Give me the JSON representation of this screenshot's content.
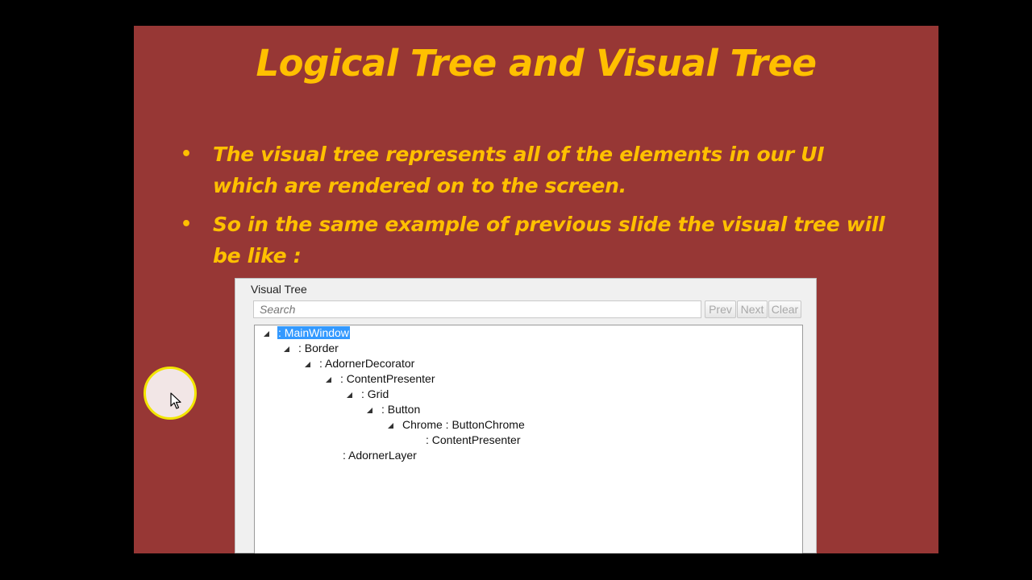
{
  "slide": {
    "title": "Logical Tree and Visual Tree",
    "bullets": [
      "The visual tree represents all of the elements in our UI which are rendered on to the screen.",
      "So in the same example of previous slide the visual tree will be like :"
    ],
    "bullet_glyph": "•"
  },
  "visual_tree_panel": {
    "title": "Visual Tree",
    "search_placeholder": "Search",
    "prev_label": "Prev",
    "next_label": "Next",
    "clear_label": "Clear",
    "nodes": [
      {
        "label": ": MainWindow",
        "expanded": true,
        "selected": true
      },
      {
        "label": ": Border",
        "expanded": true
      },
      {
        "label": ": AdornerDecorator",
        "expanded": true
      },
      {
        "label": ": ContentPresenter",
        "expanded": true
      },
      {
        "label": ": Grid",
        "expanded": true
      },
      {
        "label": ": Button",
        "expanded": true
      },
      {
        "label": "Chrome : ButtonChrome",
        "expanded": true
      },
      {
        "label": ": ContentPresenter",
        "expanded": false
      },
      {
        "label": ": AdornerLayer",
        "expanded": false
      }
    ]
  },
  "colors": {
    "slide_background": "#973735",
    "accent_text": "#FFC000",
    "selection": "#3399ff",
    "cursor_highlight": "#f2e600"
  },
  "icons": {
    "pointer": "mouse-pointer-icon",
    "expand": "expanded-triangle-icon"
  }
}
